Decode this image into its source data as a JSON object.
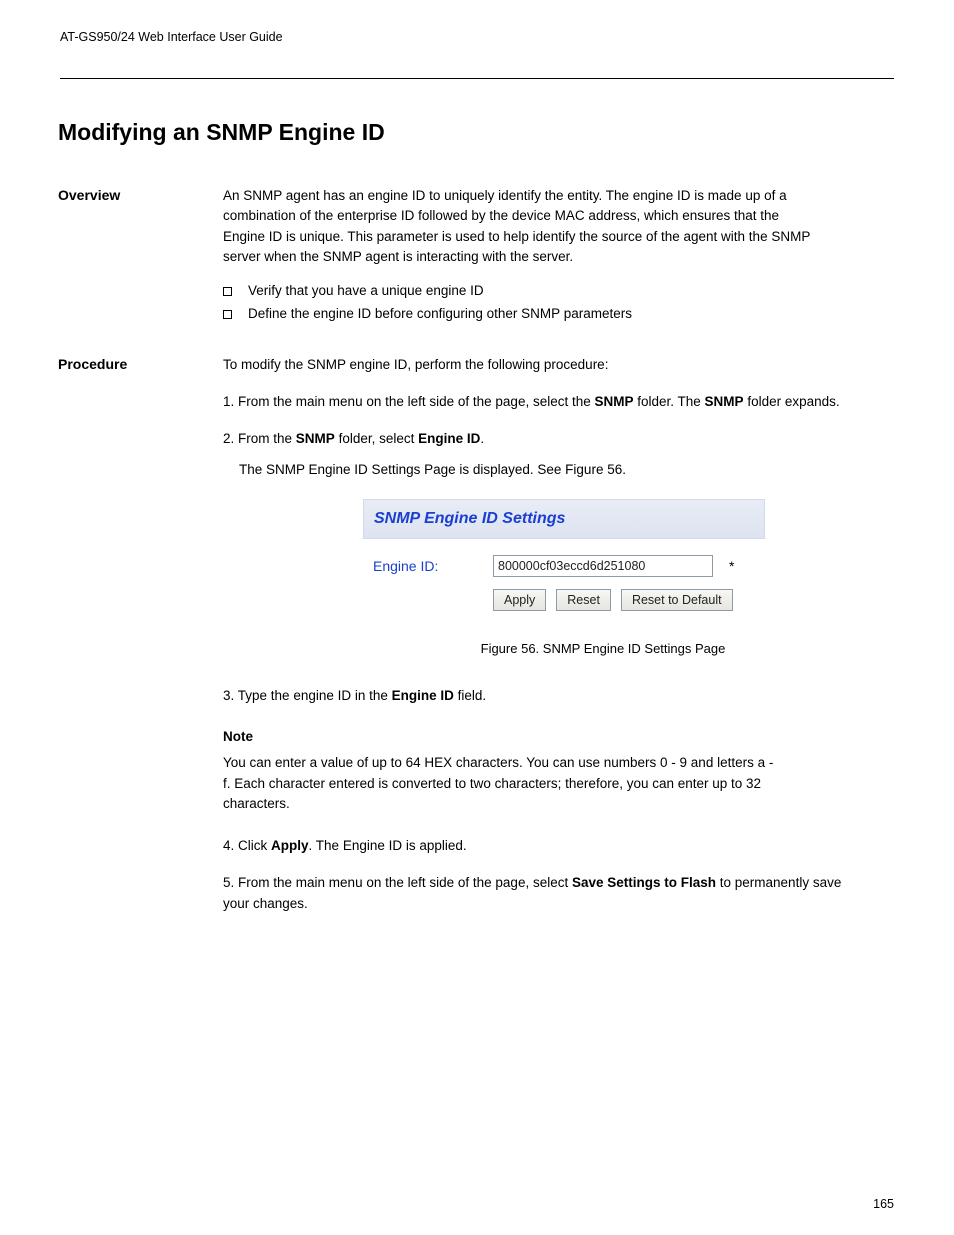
{
  "header": {
    "left": "AT-GS950/24 Web Interface User Guide",
    "right": ""
  },
  "title": "Modifying an SNMP Engine ID",
  "overview": {
    "label": "Overview",
    "intro": "An SNMP agent has an engine ID to uniquely identify the entity. The engine ID is made up of a combination of the enterprise ID followed by the device MAC address, which ensures that the Engine ID is unique. This parameter is used to help identify the source of the agent with the SNMP server when the SNMP agent is interacting with the server.",
    "bullets": [
      "Verify that you have a unique engine ID",
      "Define the engine ID before configuring other SNMP parameters"
    ]
  },
  "procedure": {
    "label": "Procedure",
    "intro": "To modify the SNMP engine ID, perform the following procedure:",
    "steps": [
      {
        "num": "1.",
        "html": "From the main menu on the left side of the page, select the <b>SNMP</b> folder. The <b>SNMP</b> folder expands."
      },
      {
        "num": "2.",
        "html": "From the <b>SNMP</b> folder, select <b>Engine ID</b>."
      },
      {
        "num": "",
        "html": "The SNMP Engine ID Settings Page is displayed. See Figure 56."
      }
    ]
  },
  "figure": {
    "panel_title": "SNMP Engine ID Settings",
    "field_label": "Engine ID:",
    "input_value": "800000cf03eccd6d251080",
    "buttons": {
      "apply": "Apply",
      "reset": "Reset",
      "reset_default": "Reset to Default"
    },
    "caption": "Figure 56. SNMP Engine ID Settings Page"
  },
  "after": {
    "step3": {
      "num": "3.",
      "html": "Type the engine ID in the <b>Engine ID</b> field."
    },
    "note_label": "Note",
    "note_text": "You can enter a value of up to 64 HEX characters. You can use numbers 0 - 9 and letters a - f. Each character entered is converted to two characters; therefore, you can enter up to 32 characters.",
    "step4": {
      "num": "4.",
      "html": "Click <b>Apply</b>. The Engine ID is applied."
    },
    "step5": {
      "num": "5.",
      "html": "From the main menu on the left side of the page, select <b>Save Settings to Flash</b> to permanently save your changes."
    }
  },
  "page_number": "165"
}
